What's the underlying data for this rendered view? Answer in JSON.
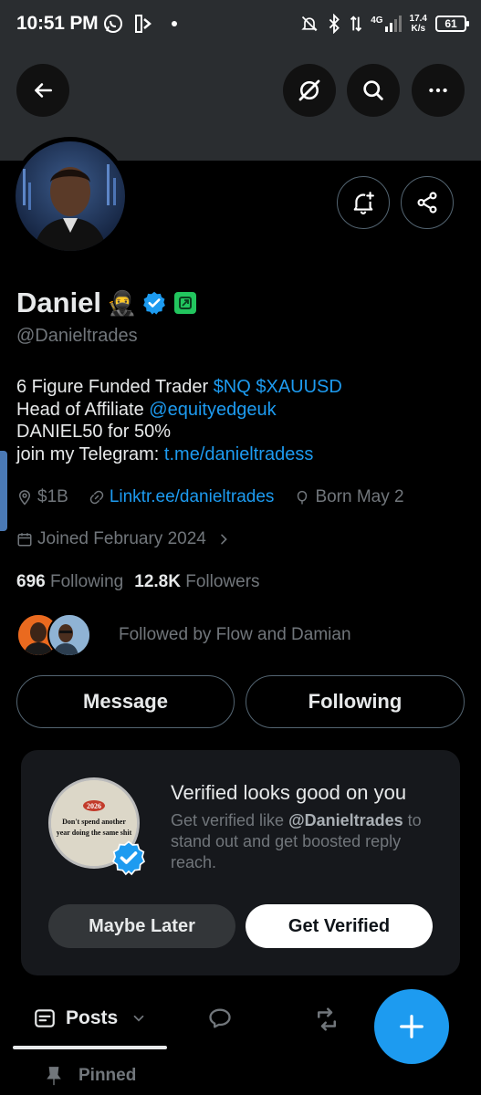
{
  "status_bar": {
    "time": "10:51 PM",
    "network_type": "4G",
    "net_speed_value": "17.4",
    "net_speed_unit": "K/s",
    "battery": "61"
  },
  "header": {
    "back_icon": "arrow-left-icon",
    "grok_icon": "grok-slash-icon",
    "search_icon": "search-icon",
    "more_icon": "more-horizontal-icon"
  },
  "profile": {
    "name": "Daniel",
    "name_emoji": "🥷",
    "handle": "@Danieltrades",
    "bio": {
      "line1_text": "6 Figure Funded Trader ",
      "line1_link": "$NQ $XAUUSD",
      "line2_text": "Head of Affiliate ",
      "line2_link": "@equityedgeuk",
      "line3_text": "DANIEL50 for 50%",
      "line4_text": "join my Telegram: ",
      "line4_link": "t.me/danieltradess"
    },
    "location": "$1B",
    "website": "Linktr.ee/danieltrades",
    "birthday": "Born May 2",
    "joined": "Joined February 2024",
    "following_count": "696",
    "following_label": "Following",
    "followers_count": "12.8K",
    "followers_label": "Followers",
    "followed_by": "Followed by Flow and Damian"
  },
  "actions": {
    "message": "Message",
    "following": "Following"
  },
  "verified_card": {
    "title": "Verified looks good on you",
    "sub_prefix": "Get verified like ",
    "sub_handle": "@Danieltrades",
    "sub_suffix": " to stand out and get boosted reply reach.",
    "badge_year": "2026",
    "badge_line1": "Don't spend another",
    "badge_line2": "year doing the same shit",
    "maybe_later": "Maybe Later",
    "get_verified": "Get Verified"
  },
  "tabs": {
    "posts": "Posts"
  },
  "pinned": "Pinned",
  "colors": {
    "accent": "#1d9bf0",
    "background": "#000000",
    "banner": "#2a2d30",
    "muted": "#71767b",
    "affiliate_green": "#22c55e"
  }
}
